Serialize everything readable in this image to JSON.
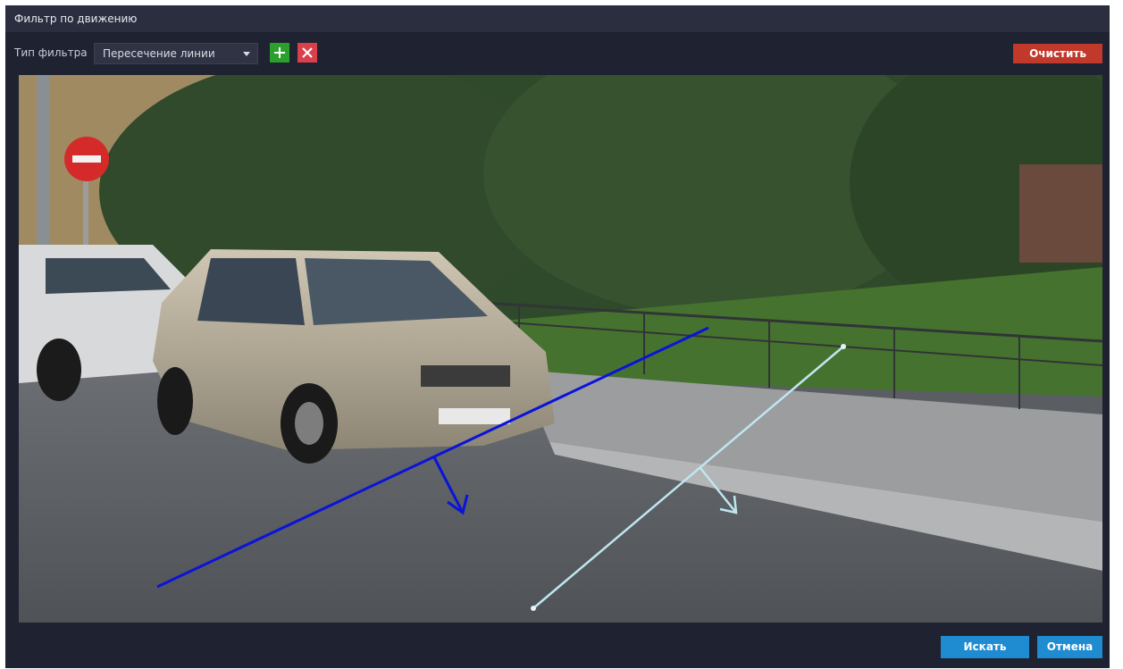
{
  "dialog": {
    "title": "Фильтр по движению"
  },
  "toolbar": {
    "filter_type_label": "Тип фильтра",
    "filter_type_value": "Пересечение линии",
    "add_icon": "plus-icon",
    "delete_icon": "close-icon",
    "clear_label": "Очистить"
  },
  "footer": {
    "search_label": "Искать",
    "cancel_label": "Отмена"
  },
  "colors": {
    "background": "#1f2231",
    "titlebar": "#2b2e3f",
    "add_button": "#2ca02c",
    "delete_button": "#d9404a",
    "clear_button": "#c0392b",
    "primary_button": "#1f8bd0",
    "line_1": "#0a14d8",
    "line_2": "#bfe6ef"
  }
}
